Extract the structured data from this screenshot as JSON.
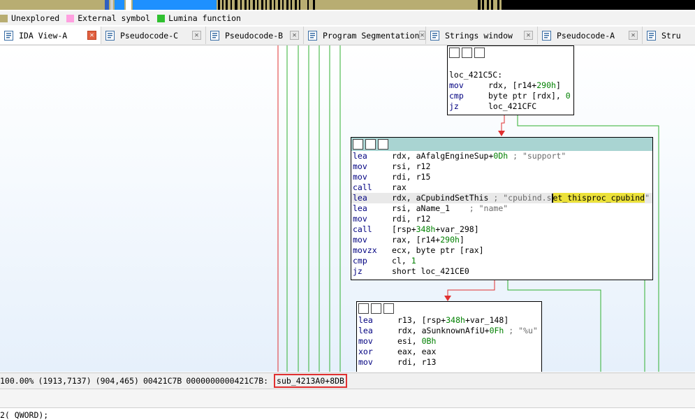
{
  "legend": [
    {
      "label": "Unexplored",
      "color": "#b8ad72"
    },
    {
      "label": "External symbol",
      "color": "#ffa0e0"
    },
    {
      "label": "Lumina function",
      "color": "#30c030"
    }
  ],
  "tabs": [
    {
      "label": "IDA View-A",
      "icon": "graph-view-icon",
      "active": true
    },
    {
      "label": "Pseudocode-C",
      "icon": "pseudocode-icon"
    },
    {
      "label": "Pseudocode-B",
      "icon": "pseudocode-icon"
    },
    {
      "label": "Program Segmentation",
      "icon": "segmentation-icon"
    },
    {
      "label": "Strings window",
      "icon": "strings-icon"
    },
    {
      "label": "Pseudocode-A",
      "icon": "pseudocode-icon"
    },
    {
      "label": "Stru",
      "icon": "structures-icon"
    }
  ],
  "nodes": {
    "n1": {
      "label": "loc_421C5C:",
      "lines": [
        {
          "mn": "mov",
          "ops": [
            {
              "t": "rdx, [r14+"
            },
            {
              "t": "290h",
              "c": "num"
            },
            {
              "t": "]"
            }
          ]
        },
        {
          "mn": "cmp",
          "ops": [
            {
              "t": "byte ptr [rdx], "
            },
            {
              "t": "0",
              "c": "num"
            }
          ]
        },
        {
          "mn": "jz",
          "ops": [
            {
              "t": "loc_421CFC"
            }
          ]
        }
      ]
    },
    "n2": {
      "lines": [
        {
          "mn": "lea",
          "ops": [
            {
              "t": "rdx, aAfalgEngineSup+"
            },
            {
              "t": "0Dh",
              "c": "num"
            },
            {
              "t": " ; \"support\"",
              "c": "cmt"
            }
          ]
        },
        {
          "mn": "mov",
          "ops": [
            {
              "t": "rsi, r12"
            }
          ]
        },
        {
          "mn": "mov",
          "ops": [
            {
              "t": "rdi, r15"
            }
          ]
        },
        {
          "mn": "call",
          "ops": [
            {
              "t": "rax"
            }
          ]
        },
        {
          "mn": "lea",
          "sel": true,
          "ops": [
            {
              "t": "rdx, aCpubindSetThis"
            },
            {
              "t": " ; \"cpubind.s",
              "c": "cmt"
            },
            {
              "t": "",
              "cursor": true
            },
            {
              "t": "et_thisproc_cpubind",
              "c": "hl"
            },
            {
              "t": "\"",
              "c": "cmt"
            }
          ]
        },
        {
          "mn": "lea",
          "ops": [
            {
              "t": "rsi, aName_1"
            },
            {
              "t": "    ; \"name\"",
              "c": "cmt"
            }
          ]
        },
        {
          "mn": "mov",
          "ops": [
            {
              "t": "rdi, r12"
            }
          ]
        },
        {
          "mn": "call",
          "ops": [
            {
              "t": "[rsp+"
            },
            {
              "t": "348h",
              "c": "num"
            },
            {
              "t": "+var_298]"
            }
          ]
        },
        {
          "mn": "mov",
          "ops": [
            {
              "t": "rax, [r14+"
            },
            {
              "t": "290h",
              "c": "num"
            },
            {
              "t": "]"
            }
          ]
        },
        {
          "mn": "movzx",
          "ops": [
            {
              "t": "ecx, byte ptr [rax]"
            }
          ]
        },
        {
          "mn": "cmp",
          "ops": [
            {
              "t": "cl, "
            },
            {
              "t": "1",
              "c": "num"
            }
          ]
        },
        {
          "mn": "jz",
          "ops": [
            {
              "t": "short loc_421CE0"
            }
          ]
        }
      ]
    },
    "n3": {
      "lines": [
        {
          "mn": "lea",
          "ops": [
            {
              "t": "r13, [rsp+"
            },
            {
              "t": "348h",
              "c": "num"
            },
            {
              "t": "+var_148]"
            }
          ]
        },
        {
          "mn": "lea",
          "ops": [
            {
              "t": "rdx, aSunknownAfiU+"
            },
            {
              "t": "0Fh",
              "c": "num"
            },
            {
              "t": " ; \"%u\"",
              "c": "cmt"
            }
          ]
        },
        {
          "mn": "mov",
          "ops": [
            {
              "t": "esi, "
            },
            {
              "t": "0Bh",
              "c": "num"
            }
          ]
        },
        {
          "mn": "xor",
          "ops": [
            {
              "t": "eax, eax"
            }
          ]
        },
        {
          "mn": "mov",
          "ops": [
            {
              "t": "rdi, r13"
            }
          ]
        }
      ]
    }
  },
  "status": {
    "zoom": "100.00%",
    "graph_coords": "(1913,7137)",
    "mouse_coords": "(904,465)",
    "offset": "00421C7B",
    "address": "0000000000421C7B:",
    "location": "sub_4213A0+8DB"
  },
  "bottom_text": "2( QWORD);",
  "colors": {
    "node_header": "#a9d4d2",
    "edge_true": "#30b030",
    "edge_false": "#e03030",
    "highlight": "#ece23a",
    "mnemonic": "#000080",
    "number": "#008000"
  }
}
